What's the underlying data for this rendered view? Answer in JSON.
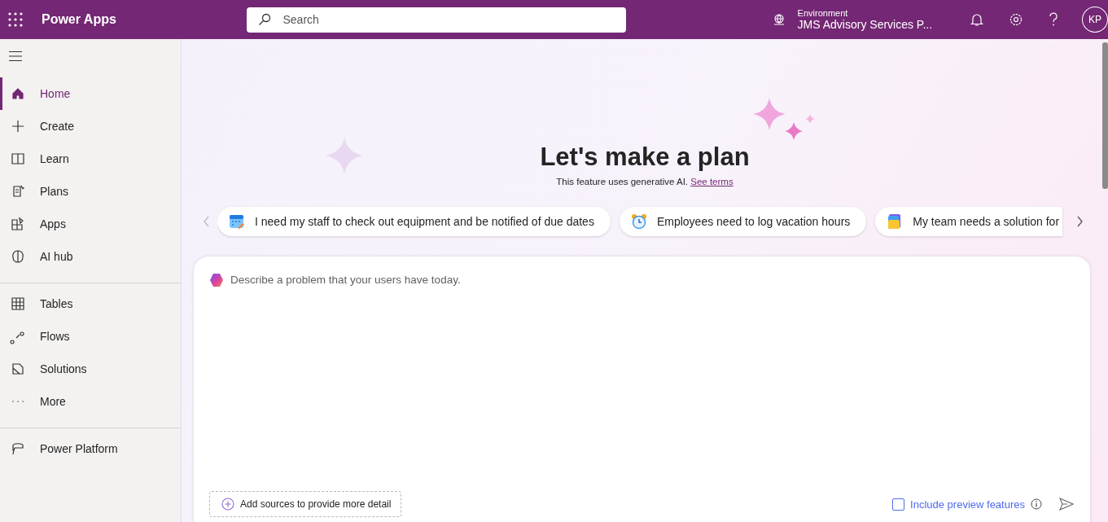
{
  "header": {
    "app_name": "Power Apps",
    "search": {
      "placeholder": "Search"
    },
    "environment": {
      "label": "Environment",
      "value": "JMS Advisory Services P..."
    },
    "avatar": "KP"
  },
  "sidebar": {
    "groups": [
      [
        {
          "label": "Home",
          "selected": true
        },
        {
          "label": "Create",
          "selected": false
        },
        {
          "label": "Learn",
          "selected": false
        },
        {
          "label": "Plans",
          "selected": false
        },
        {
          "label": "Apps",
          "selected": false
        },
        {
          "label": "AI hub",
          "selected": false
        }
      ],
      [
        {
          "label": "Tables",
          "selected": false
        },
        {
          "label": "Flows",
          "selected": false
        },
        {
          "label": "Solutions",
          "selected": false
        },
        {
          "label": "More",
          "selected": false
        }
      ],
      [
        {
          "label": "Power Platform",
          "selected": false
        }
      ]
    ]
  },
  "hero": {
    "title": "Let's make a plan",
    "subtitle": "This feature uses generative AI.",
    "terms_link": "See terms"
  },
  "suggestions": [
    {
      "text": "I need my staff to check out equipment and be notified of due dates"
    },
    {
      "text": "Employees need to log vacation hours"
    },
    {
      "text": "My team needs a solution for"
    }
  ],
  "prompt": {
    "placeholder": "Describe a problem that your users have today.",
    "add_sources": "Add sources to provide more detail",
    "preview_option": {
      "label": "Include preview features",
      "checked": false
    }
  }
}
